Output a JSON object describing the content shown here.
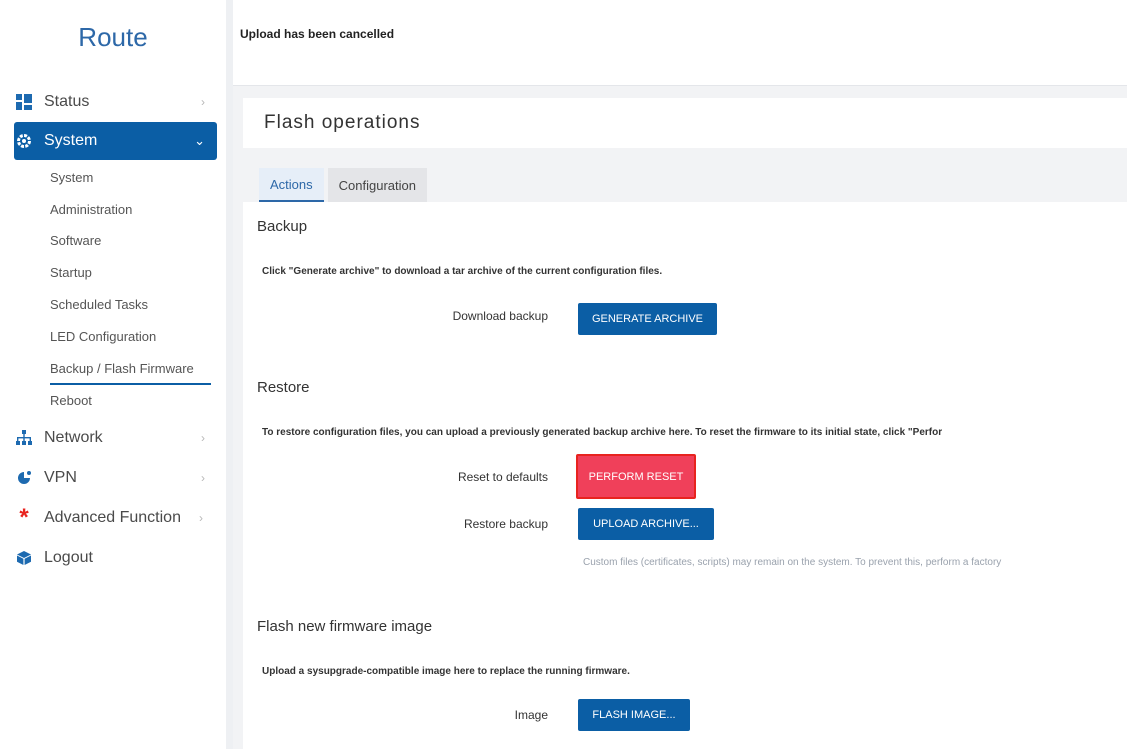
{
  "brand": "Route",
  "sidebar": {
    "items": [
      {
        "label": "Status",
        "icon": "dashboard-icon"
      },
      {
        "label": "System",
        "icon": "gear-icon"
      },
      {
        "label": "Network",
        "icon": "network-icon"
      },
      {
        "label": "VPN",
        "icon": "vpn-icon"
      },
      {
        "label": "Advanced Function",
        "icon": "asterisk-icon"
      },
      {
        "label": "Logout",
        "icon": "logout-icon"
      }
    ],
    "sub_items": [
      {
        "label": "System"
      },
      {
        "label": "Administration"
      },
      {
        "label": "Software"
      },
      {
        "label": "Startup"
      },
      {
        "label": "Scheduled Tasks"
      },
      {
        "label": "LED Configuration"
      },
      {
        "label": "Backup / Flash Firmware"
      },
      {
        "label": "Reboot"
      }
    ]
  },
  "topbar": {
    "message": "Upload has been cancelled"
  },
  "page": {
    "title": "Flash operations"
  },
  "tabs": [
    {
      "label": "Actions"
    },
    {
      "label": "Configuration"
    }
  ],
  "backup": {
    "heading": "Backup",
    "note": "Click \"Generate archive\" to download a tar archive of the current configuration files.",
    "label": "Download backup",
    "button": "GENERATE ARCHIVE"
  },
  "restore": {
    "heading": "Restore",
    "note": "To restore configuration files, you can upload a previously generated backup archive here. To reset the firmware to its initial state, click \"Perfor",
    "reset_label": "Reset to defaults",
    "reset_button": "PERFORM RESET",
    "restore_label": "Restore backup",
    "restore_button": "UPLOAD ARCHIVE...",
    "hint": "Custom files (certificates, scripts) may remain on the system. To prevent this, perform a factory"
  },
  "flash": {
    "heading": "Flash new firmware image",
    "note": "Upload a sysupgrade-compatible image here to replace the running firmware.",
    "label": "Image",
    "button": "FLASH IMAGE..."
  },
  "colors": {
    "primary": "#0b5ea5",
    "danger": "#f0405a",
    "brand": "#2d68a8"
  }
}
